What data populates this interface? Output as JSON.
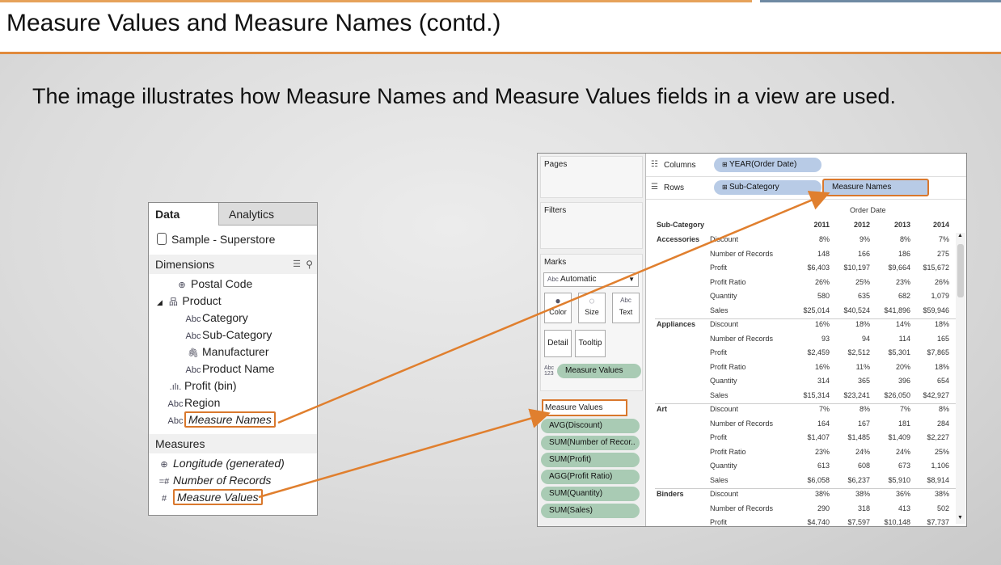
{
  "slide": {
    "title": "Measure Values and Measure Names (contd.)",
    "subtitle": "The image illustrates how Measure Names and Measure Values fields in a view are used."
  },
  "data_pane": {
    "tabs": [
      "Data",
      "Analytics"
    ],
    "datasource": "Sample - Superstore",
    "dimensions_label": "Dimensions",
    "dimensions": [
      {
        "icon": "globe-icon",
        "glyph": "⊕",
        "label": "Postal Code"
      },
      {
        "icon": "hierarchy-icon",
        "glyph": "品",
        "label": "Product"
      },
      {
        "icon": "abc-icon",
        "glyph": "Abc",
        "label": "Category"
      },
      {
        "icon": "abc-icon",
        "glyph": "Abc",
        "label": "Sub-Category"
      },
      {
        "icon": "paperclip-icon",
        "glyph": "🖇",
        "label": "Manufacturer"
      },
      {
        "icon": "abc-icon",
        "glyph": "Abc",
        "label": "Product Name"
      },
      {
        "icon": "bin-icon",
        "glyph": ".ılı.",
        "label": "Profit (bin)"
      },
      {
        "icon": "abc-icon",
        "glyph": "Abc",
        "label": "Region"
      },
      {
        "icon": "abc-icon",
        "glyph": "Abc",
        "label": "Measure Names"
      }
    ],
    "measures_label": "Measures",
    "measures": [
      {
        "icon": "globe-icon",
        "glyph": "⊕",
        "label": "Longitude (generated)"
      },
      {
        "icon": "hash-icon",
        "glyph": "=#",
        "label": "Number of Records"
      },
      {
        "icon": "hash-icon",
        "glyph": "#",
        "label": "Measure Values"
      }
    ]
  },
  "tableau": {
    "pages_label": "Pages",
    "filters_label": "Filters",
    "marks_label": "Marks",
    "marks_type": "Automatic",
    "marks_buttons": [
      "Color",
      "Size",
      "Text"
    ],
    "detail_buttons": [
      "Detail",
      "Tooltip"
    ],
    "marks_pill": "Measure Values",
    "measure_values_card_label": "Measure Values",
    "measure_values_pills": [
      "AVG(Discount)",
      "SUM(Number of Recor..",
      "SUM(Profit)",
      "AGG(Profit Ratio)",
      "SUM(Quantity)",
      "SUM(Sales)"
    ],
    "columns_label": "Columns",
    "columns_pill": "YEAR(Order Date)",
    "rows_label": "Rows",
    "rows_pills": [
      "Sub-Category",
      "Measure Names"
    ],
    "table": {
      "header_group": "Order Date",
      "row_header": "Sub-Category",
      "years": [
        "2011",
        "2012",
        "2013",
        "2014"
      ],
      "groups": [
        {
          "name": "Accessories",
          "rows": [
            {
              "m": "Discount",
              "v": [
                "8%",
                "9%",
                "8%",
                "7%"
              ]
            },
            {
              "m": "Number of Records",
              "v": [
                "148",
                "166",
                "186",
                "275"
              ]
            },
            {
              "m": "Profit",
              "v": [
                "$6,403",
                "$10,197",
                "$9,664",
                "$15,672"
              ]
            },
            {
              "m": "Profit Ratio",
              "v": [
                "26%",
                "25%",
                "23%",
                "26%"
              ]
            },
            {
              "m": "Quantity",
              "v": [
                "580",
                "635",
                "682",
                "1,079"
              ]
            },
            {
              "m": "Sales",
              "v": [
                "$25,014",
                "$40,524",
                "$41,896",
                "$59,946"
              ]
            }
          ]
        },
        {
          "name": "Appliances",
          "rows": [
            {
              "m": "Discount",
              "v": [
                "16%",
                "18%",
                "14%",
                "18%"
              ]
            },
            {
              "m": "Number of Records",
              "v": [
                "93",
                "94",
                "114",
                "165"
              ]
            },
            {
              "m": "Profit",
              "v": [
                "$2,459",
                "$2,512",
                "$5,301",
                "$7,865"
              ]
            },
            {
              "m": "Profit Ratio",
              "v": [
                "16%",
                "11%",
                "20%",
                "18%"
              ]
            },
            {
              "m": "Quantity",
              "v": [
                "314",
                "365",
                "396",
                "654"
              ]
            },
            {
              "m": "Sales",
              "v": [
                "$15,314",
                "$23,241",
                "$26,050",
                "$42,927"
              ]
            }
          ]
        },
        {
          "name": "Art",
          "rows": [
            {
              "m": "Discount",
              "v": [
                "7%",
                "8%",
                "7%",
                "8%"
              ]
            },
            {
              "m": "Number of Records",
              "v": [
                "164",
                "167",
                "181",
                "284"
              ]
            },
            {
              "m": "Profit",
              "v": [
                "$1,407",
                "$1,485",
                "$1,409",
                "$2,227"
              ]
            },
            {
              "m": "Profit Ratio",
              "v": [
                "23%",
                "24%",
                "24%",
                "25%"
              ]
            },
            {
              "m": "Quantity",
              "v": [
                "613",
                "608",
                "673",
                "1,106"
              ]
            },
            {
              "m": "Sales",
              "v": [
                "$6,058",
                "$6,237",
                "$5,910",
                "$8,914"
              ]
            }
          ]
        },
        {
          "name": "Binders",
          "rows": [
            {
              "m": "Discount",
              "v": [
                "38%",
                "38%",
                "36%",
                "38%"
              ]
            },
            {
              "m": "Number of Records",
              "v": [
                "290",
                "318",
                "413",
                "502"
              ]
            },
            {
              "m": "Profit",
              "v": [
                "$4,740",
                "$7,597",
                "$10,148",
                "$7,737"
              ]
            }
          ]
        }
      ]
    }
  },
  "colors": {
    "accent": "#d9782d",
    "pill_green": "#a9cbb4",
    "pill_blue": "#b8cbe6"
  }
}
